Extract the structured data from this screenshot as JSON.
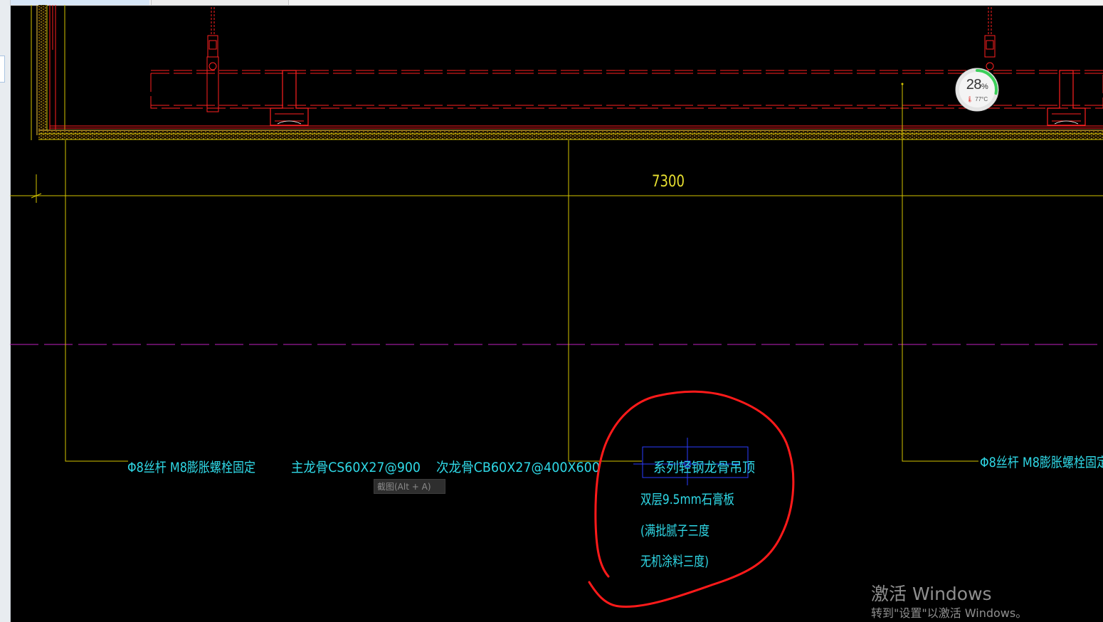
{
  "drawing": {
    "dimension": "7300",
    "annotations": {
      "left_label": "Φ8丝杆 M8膨胀螺栓固定",
      "main_keel": "主龙骨CS60X27@900",
      "secondary_keel": "次龙骨CB60X27@400X600",
      "ceiling_title": "系列轻钢龙骨吊顶",
      "board": "双层9.5mm石膏板",
      "putty": "(满批腻子三度",
      "paint": "无机涂料三度)",
      "right_label": "Φ8丝杆 M8膨胀螺栓固定"
    }
  },
  "tooltip": {
    "text": "截图(Alt + A)"
  },
  "gauge": {
    "percent": "28",
    "percent_unit": "%",
    "temp": "77°C",
    "level": 0.28
  },
  "watermark": {
    "line1": "激活 Windows",
    "line2": "转到\"设置\"以激活 Windows。"
  },
  "colors": {
    "background": "#000000",
    "frame_red": "#ff2020",
    "dim_yellow": "#d4c400",
    "text_cyan": "#2fd8e6",
    "grid_magenta": "#c020c0",
    "box_blue": "#2a3cff"
  }
}
